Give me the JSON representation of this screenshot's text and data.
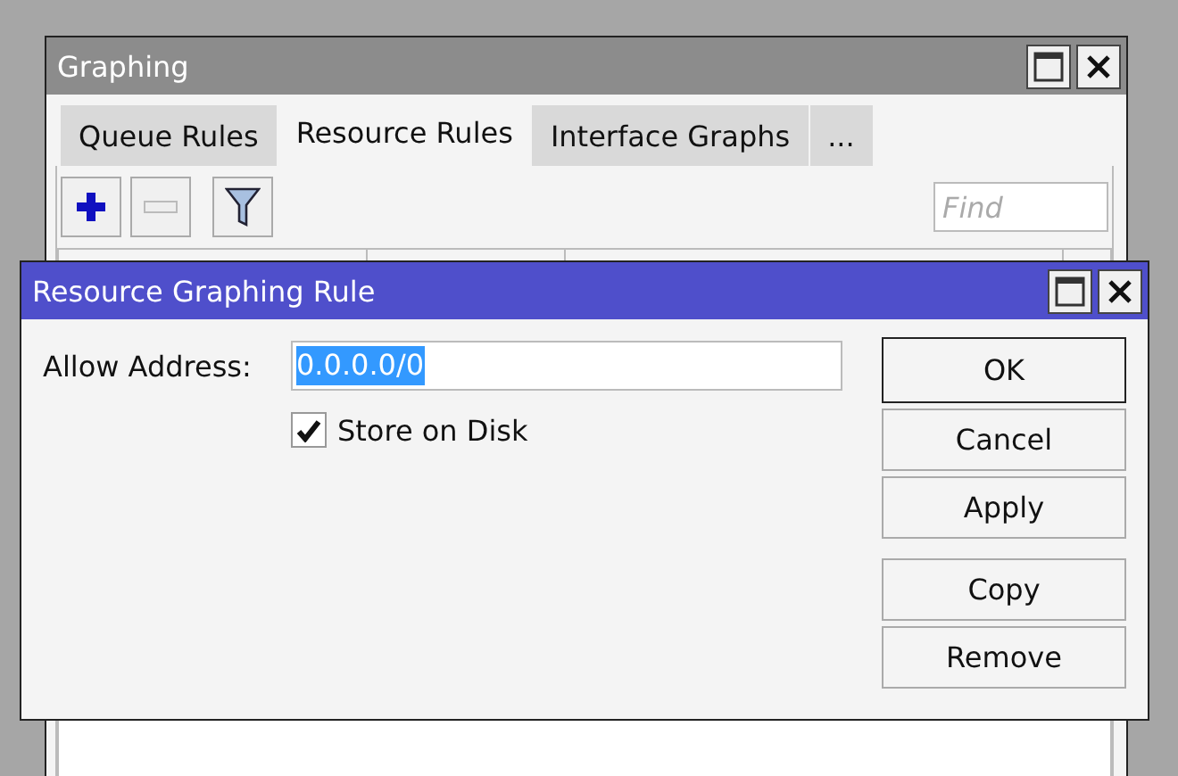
{
  "window": {
    "title": "Graphing"
  },
  "tabs": [
    {
      "label": "Queue Rules",
      "selected": false
    },
    {
      "label": "Resource Rules",
      "selected": true
    },
    {
      "label": "Interface Graphs",
      "selected": false
    },
    {
      "label": "...",
      "selected": false
    }
  ],
  "toolbar": {
    "add_disabled": false,
    "remove_disabled": true,
    "find_placeholder": "Find"
  },
  "dialog": {
    "title": "Resource Graphing Rule",
    "address_label": "Allow Address:",
    "address_value": "0.0.0.0/0",
    "address_selected": true,
    "store_on_disk": {
      "label": "Store on Disk",
      "checked": true
    },
    "buttons": [
      {
        "label": "OK",
        "default": true
      },
      {
        "label": "Cancel",
        "default": false
      },
      {
        "label": "Apply",
        "default": false
      },
      {
        "label": "Copy",
        "default": false
      },
      {
        "label": "Remove",
        "default": false
      }
    ]
  }
}
